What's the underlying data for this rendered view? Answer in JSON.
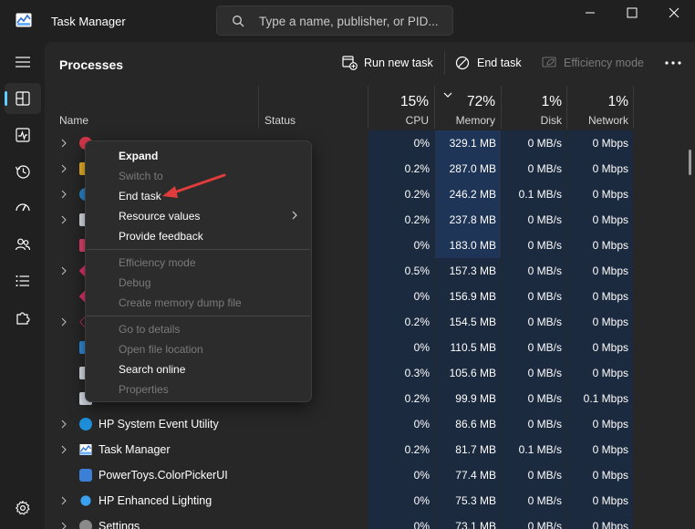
{
  "app": {
    "title": "Task Manager"
  },
  "search": {
    "placeholder": "Type a name, publisher, or PID..."
  },
  "page": {
    "title": "Processes"
  },
  "toolbar": {
    "run_new_task": "Run new task",
    "end_task": "End task",
    "efficiency_mode": "Efficiency mode"
  },
  "columns": {
    "name": "Name",
    "status": "Status",
    "cpu": {
      "percent": "15%",
      "label": "CPU"
    },
    "memory": {
      "percent": "72%",
      "label": "Memory"
    },
    "disk": {
      "percent": "1%",
      "label": "Disk"
    },
    "network": {
      "percent": "1%",
      "label": "Network"
    }
  },
  "rows": [
    {
      "name": "",
      "icon": "red-globe-icon",
      "cpu": "0%",
      "memory": "329.1 MB",
      "disk": "0 MB/s",
      "network": "0 Mbps"
    },
    {
      "name": "",
      "icon": "folder-icon",
      "cpu": "0.2%",
      "memory": "287.0 MB",
      "disk": "0 MB/s",
      "network": "0 Mbps"
    },
    {
      "name": "",
      "icon": "blue-ring-icon",
      "cpu": "0.2%",
      "memory": "246.2 MB",
      "disk": "0.1 MB/s",
      "network": "0 Mbps"
    },
    {
      "name": "",
      "icon": "window-icon",
      "cpu": "0.2%",
      "memory": "237.8 MB",
      "disk": "0 MB/s",
      "network": "0 Mbps"
    },
    {
      "name": "",
      "icon": "pink-app-icon",
      "cpu": "0%",
      "memory": "183.0 MB",
      "disk": "0 MB/s",
      "network": "0 Mbps"
    },
    {
      "name": "",
      "icon": "diamond-icon",
      "cpu": "0.5%",
      "memory": "157.3 MB",
      "disk": "0 MB/s",
      "network": "0 Mbps"
    },
    {
      "name": "",
      "icon": "diamond-icon",
      "cpu": "0%",
      "memory": "156.9 MB",
      "disk": "0 MB/s",
      "network": "0 Mbps"
    },
    {
      "name": "",
      "icon": "diamond-outline-icon",
      "cpu": "0.2%",
      "memory": "154.5 MB",
      "disk": "0 MB/s",
      "network": "0 Mbps"
    },
    {
      "name": "",
      "icon": "blue-square-icon",
      "cpu": "0%",
      "memory": "110.5 MB",
      "disk": "0 MB/s",
      "network": "0 Mbps"
    },
    {
      "name": "",
      "icon": "window-icon",
      "cpu": "0.3%",
      "memory": "105.6 MB",
      "disk": "0 MB/s",
      "network": "0 Mbps"
    },
    {
      "name": "",
      "icon": "window-icon",
      "cpu": "0.2%",
      "memory": "99.9 MB",
      "disk": "0 MB/s",
      "network": "0.1 Mbps"
    },
    {
      "name": "HP System Event Utility",
      "icon": "hp-icon",
      "cpu": "0%",
      "memory": "86.6 MB",
      "disk": "0 MB/s",
      "network": "0 Mbps"
    },
    {
      "name": "Task Manager",
      "icon": "task-manager-icon",
      "cpu": "0.2%",
      "memory": "81.7 MB",
      "disk": "0.1 MB/s",
      "network": "0 Mbps"
    },
    {
      "name": "PowerToys.ColorPickerUI",
      "icon": "color-picker-icon",
      "cpu": "0%",
      "memory": "77.4 MB",
      "disk": "0 MB/s",
      "network": "0 Mbps"
    },
    {
      "name": "HP Enhanced Lighting",
      "icon": "lighting-icon",
      "cpu": "0%",
      "memory": "75.3 MB",
      "disk": "0 MB/s",
      "network": "0 Mbps"
    },
    {
      "name": "Settings",
      "icon": "settings-gear-icon",
      "cpu": "0%",
      "memory": "73.1 MB",
      "disk": "0 MB/s",
      "network": "0 Mbps"
    }
  ],
  "context_menu": {
    "expand": "Expand",
    "switch_to": "Switch to",
    "end_task": "End task",
    "resource_values": "Resource values",
    "provide_feedback": "Provide feedback",
    "efficiency_mode": "Efficiency mode",
    "debug": "Debug",
    "create_dump": "Create memory dump file",
    "go_to_details": "Go to details",
    "open_file_location": "Open file location",
    "search_online": "Search online",
    "properties": "Properties"
  },
  "colors": {
    "background": "#202020",
    "panel": "#272727",
    "accent": "#60cdff",
    "heat_low": "#1b2a3f",
    "heat_high": "#1f3557",
    "annotation_arrow": "#e03c3c"
  }
}
